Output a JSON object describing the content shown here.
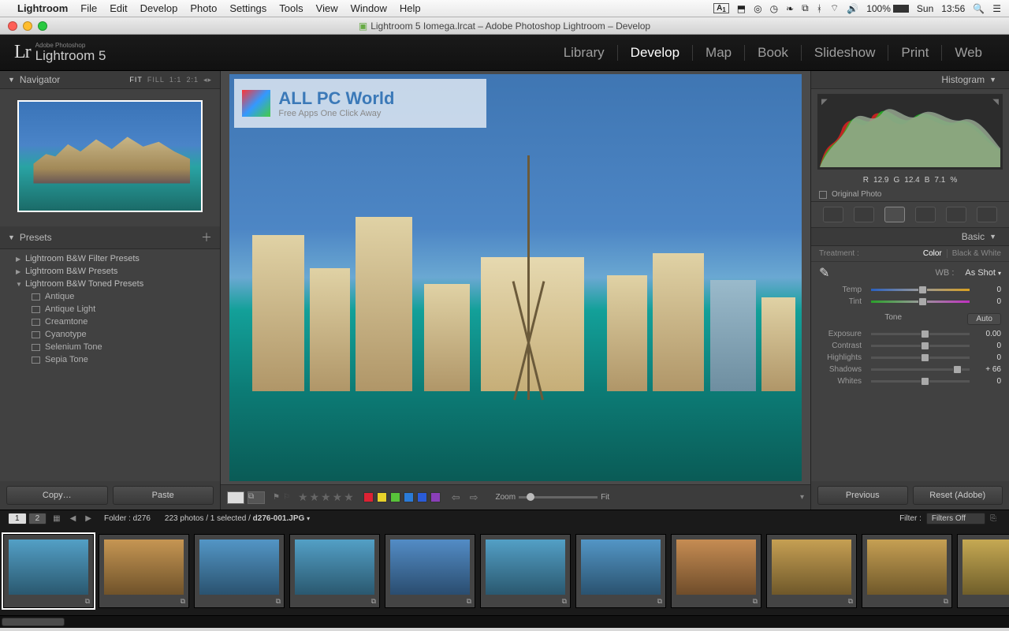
{
  "mac": {
    "app": "Lightroom",
    "menus": [
      "File",
      "Edit",
      "Develop",
      "Photo",
      "Settings",
      "Tools",
      "View",
      "Window",
      "Help"
    ],
    "battery": "100%",
    "day": "Sun",
    "time": "13:56",
    "a_badge": "1"
  },
  "window": {
    "title": "Lightroom 5 Iomega.lrcat – Adobe Photoshop Lightroom – Develop"
  },
  "header": {
    "brand_small": "Adobe Photoshop",
    "brand": "Lightroom 5",
    "modules": [
      "Library",
      "Develop",
      "Map",
      "Book",
      "Slideshow",
      "Print",
      "Web"
    ],
    "active_module": "Develop"
  },
  "left": {
    "navigator": {
      "title": "Navigator",
      "zoom_opts": [
        "FIT",
        "FILL",
        "1:1",
        "2:1"
      ],
      "zoom_active": "FIT"
    },
    "presets": {
      "title": "Presets",
      "groups": [
        {
          "name": "Lightroom B&W Filter Presets",
          "open": false
        },
        {
          "name": "Lightroom B&W Presets",
          "open": false
        },
        {
          "name": "Lightroom B&W Toned Presets",
          "open": true,
          "items": [
            "Antique",
            "Antique Light",
            "Creamtone",
            "Cyanotype",
            "Selenium Tone",
            "Sepia Tone"
          ]
        }
      ]
    },
    "copy_btn": "Copy…",
    "paste_btn": "Paste"
  },
  "watermark": {
    "line1": "ALL PC World",
    "line2": "Free Apps One Click Away"
  },
  "toolbar": {
    "stars": "★★★★★",
    "swatches": [
      "#d23",
      "#e8d22a",
      "#58c23a",
      "#2a7bd8",
      "#2a5bd8",
      "#8a3fb8"
    ],
    "zoom_label": "Zoom",
    "fit_label": "Fit"
  },
  "right": {
    "histogram": {
      "title": "Histogram",
      "r": "12.9",
      "g": "12.4",
      "b": "7.1",
      "pct": "%",
      "rl": "R",
      "gl": "G",
      "bl": "B"
    },
    "orig": "Original Photo",
    "basic": {
      "title": "Basic",
      "treatment_label": "Treatment :",
      "color": "Color",
      "bw": "Black & White",
      "wb_label": "WB :",
      "wb_value": "As Shot",
      "temp": "Temp",
      "tint": "Tint",
      "temp_v": "0",
      "tint_v": "0",
      "tone": "Tone",
      "auto": "Auto",
      "sliders": [
        {
          "name": "Exposure",
          "value": "0.00",
          "pos": 50
        },
        {
          "name": "Contrast",
          "value": "0",
          "pos": 50
        },
        {
          "name": "Highlights",
          "value": "0",
          "pos": 50
        },
        {
          "name": "Shadows",
          "value": "+ 66",
          "pos": 83
        },
        {
          "name": "Whites",
          "value": "0",
          "pos": 50
        }
      ]
    },
    "prev": "Previous",
    "reset": "Reset (Adobe)"
  },
  "filmstrip": {
    "tabs": [
      "1",
      "2"
    ],
    "folder_label": "Folder :",
    "folder": "d276",
    "status": "223 photos / 1 selected /",
    "file": "d276-001.JPG",
    "filter_label": "Filter :",
    "filter_value": "Filters Off",
    "count": 12
  }
}
